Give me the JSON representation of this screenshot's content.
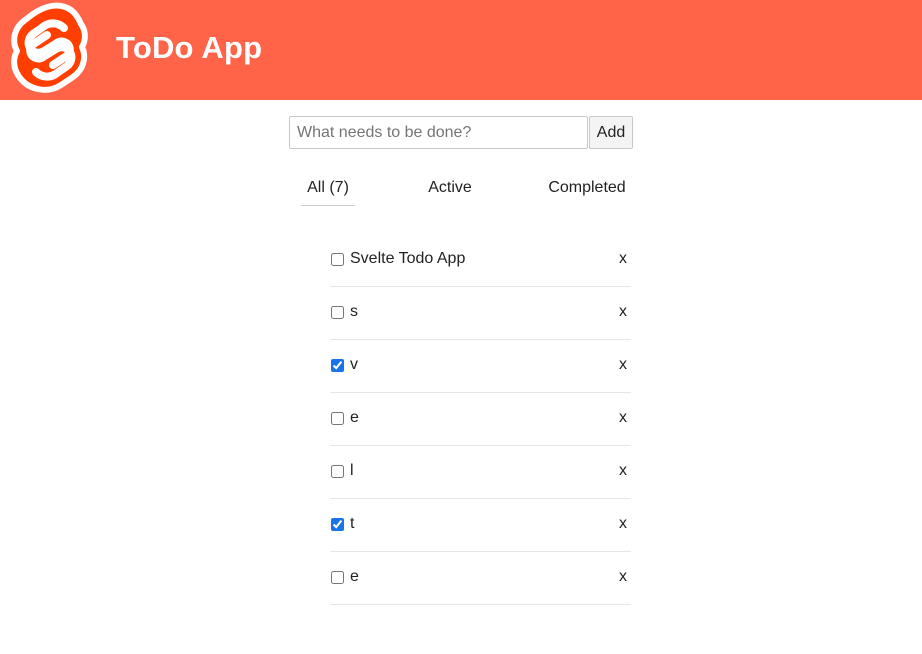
{
  "header": {
    "title": "ToDo App",
    "logo_icon": "svelte-logo-icon",
    "background_color": "#ff6448"
  },
  "form": {
    "placeholder": "What needs to be done?",
    "value": "",
    "add_label": "Add"
  },
  "filters": [
    {
      "label": "All (7)",
      "active": true
    },
    {
      "label": "Active",
      "active": false
    },
    {
      "label": "Completed",
      "active": false
    }
  ],
  "todos": [
    {
      "text": "Svelte Todo App",
      "done": false,
      "delete_label": "x"
    },
    {
      "text": "s",
      "done": false,
      "delete_label": "x"
    },
    {
      "text": "v",
      "done": true,
      "delete_label": "x"
    },
    {
      "text": "e",
      "done": false,
      "delete_label": "x"
    },
    {
      "text": "l",
      "done": false,
      "delete_label": "x"
    },
    {
      "text": "t",
      "done": true,
      "delete_label": "x"
    },
    {
      "text": "e",
      "done": false,
      "delete_label": "x"
    }
  ],
  "colors": {
    "accent": "#ff6448",
    "checkbox": "#1a73e8"
  }
}
